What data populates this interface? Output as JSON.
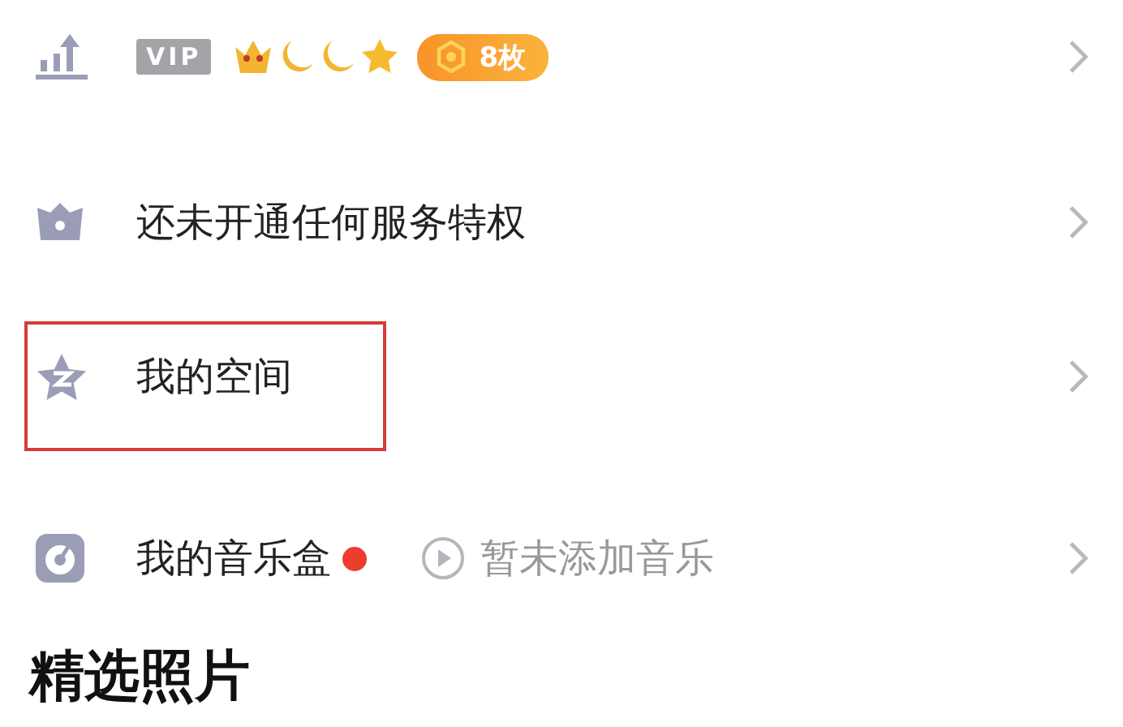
{
  "rows": [
    {
      "kind": "level",
      "vip": "VIP",
      "coins": "8枚"
    },
    {
      "kind": "service",
      "label": "还未开通任何服务特权",
      "highlighted": false
    },
    {
      "kind": "space",
      "label": "我的空间",
      "highlighted": true
    },
    {
      "kind": "music",
      "label": "我的音乐盒",
      "new_dot": true,
      "hint": "暂未添加音乐",
      "highlighted": false
    }
  ],
  "section_title": "精选照片"
}
